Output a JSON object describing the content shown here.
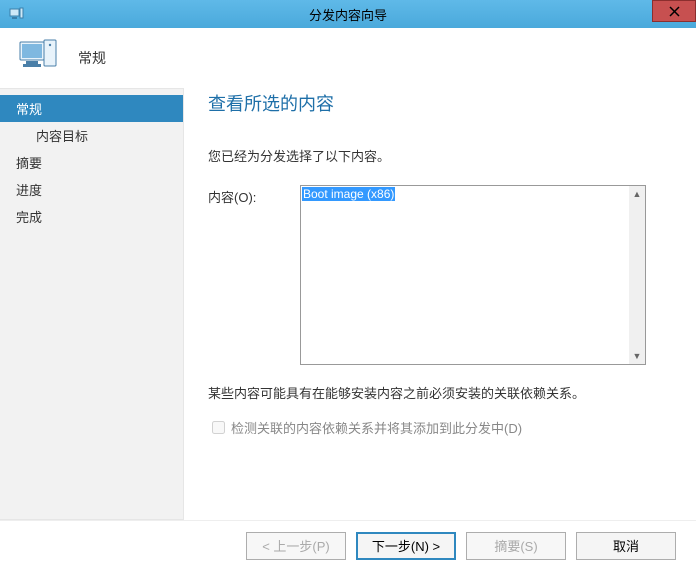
{
  "titlebar": {
    "title": "分发内容向导"
  },
  "header": {
    "label": "常规"
  },
  "sidebar": {
    "items": [
      {
        "label": "常规",
        "active": true
      },
      {
        "label": "内容目标",
        "sub": true
      },
      {
        "label": "摘要"
      },
      {
        "label": "进度"
      },
      {
        "label": "完成"
      }
    ]
  },
  "content": {
    "page_title": "查看所选的内容",
    "subtext": "您已经为分发选择了以下内容。",
    "list_label": "内容(O):",
    "selected_item": "Boot image (x86)",
    "depnote": "某些内容可能具有在能够安装内容之前必须安装的关联依赖关系。",
    "checkbox_label": "检测关联的内容依赖关系并将其添加到此分发中(D)"
  },
  "footer": {
    "prev": "< 上一步(P)",
    "next": "下一步(N) >",
    "summary": "摘要(S)",
    "cancel": "取消"
  }
}
